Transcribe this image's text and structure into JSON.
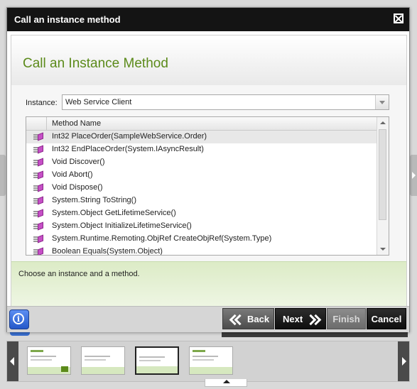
{
  "dialog": {
    "title": "Call an instance method",
    "heading": "Call an Instance Method",
    "instance": {
      "label": "Instance:",
      "value": "Web Service Client"
    },
    "methods": {
      "column_header": "Method Name",
      "rows": [
        "Int32 PlaceOrder(SampleWebService.Order)",
        "Int32 EndPlaceOrder(System.IAsyncResult)",
        "Void Discover()",
        "Void Abort()",
        "Void Dispose()",
        "System.String ToString()",
        "System.Object GetLifetimeService()",
        "System.Object InitializeLifetimeService()",
        "System.Runtime.Remoting.ObjRef CreateObjRef(System.Type)",
        "Boolean Equals(System.Object)"
      ],
      "selected_index": 0,
      "row_icon": "method-icon"
    },
    "info_message": "Choose an instance and a method."
  },
  "footer": {
    "help_icon": "info-icon",
    "help_glyph": "i",
    "back_label": "Back",
    "next_label": "Next",
    "finish_label": "Finish",
    "cancel_label": "Cancel"
  },
  "thumbnails": {
    "count": 4,
    "selected_index": 2
  },
  "colors": {
    "heading_green": "#5b8a1a",
    "titlebar": "#141414",
    "info_bg": "#dcebc6"
  }
}
